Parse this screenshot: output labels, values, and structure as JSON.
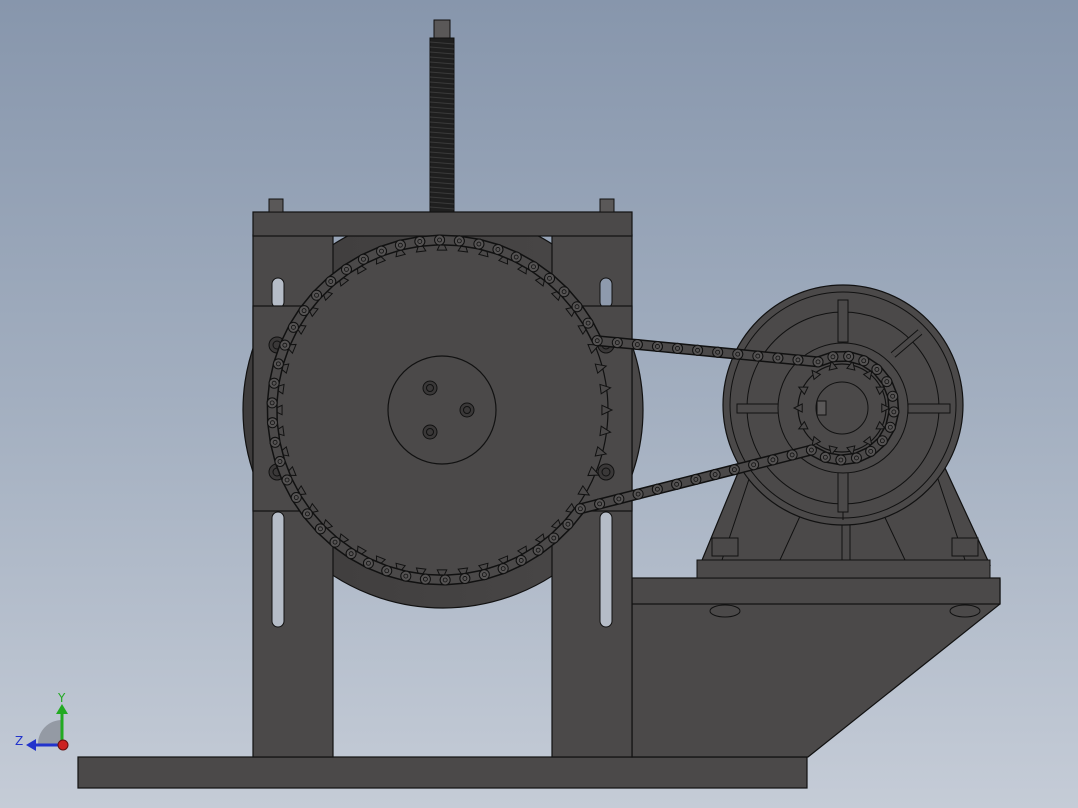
{
  "viewport": {
    "background_top": "#8796ac",
    "background_bottom": "#c5ccd7"
  },
  "model": {
    "body_color": "#4b4949",
    "edge_color": "#111111",
    "highlight_color": "#5c5a5a"
  },
  "triad": {
    "y_label": "Y",
    "z_label": "Z",
    "x_color": "#cc2222",
    "y_color": "#22aa22",
    "z_color": "#2233cc"
  }
}
